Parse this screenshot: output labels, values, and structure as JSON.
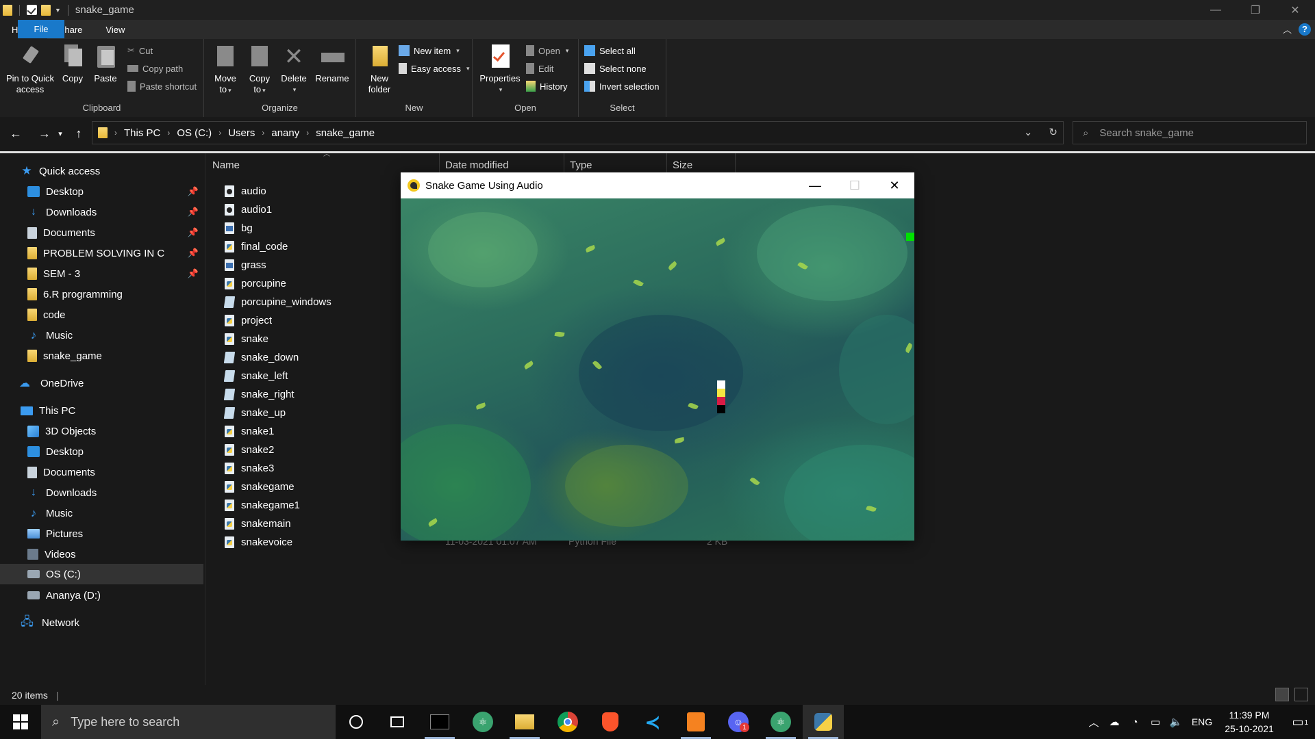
{
  "explorer": {
    "window_title": "snake_game",
    "tabs": [
      "File",
      "Home",
      "Share",
      "View"
    ],
    "ribbon": {
      "clipboard": {
        "label": "Clipboard",
        "pin": "Pin to Quick access",
        "pin_l1": "Pin to Quick",
        "pin_l2": "access",
        "copy": "Copy",
        "paste": "Paste",
        "cut": "Cut",
        "copy_path": "Copy path",
        "paste_shortcut": "Paste shortcut"
      },
      "organize": {
        "label": "Organize",
        "move_l1": "Move",
        "move_l2": "to",
        "copy_l1": "Copy",
        "copy_l2": "to",
        "delete": "Delete",
        "rename": "Rename"
      },
      "new": {
        "label": "New",
        "folder_l1": "New",
        "folder_l2": "folder",
        "new_item": "New item",
        "easy_access": "Easy access"
      },
      "open": {
        "label": "Open",
        "properties": "Properties",
        "open": "Open",
        "edit": "Edit",
        "history": "History"
      },
      "select": {
        "label": "Select",
        "select_all": "Select all",
        "select_none": "Select none",
        "invert": "Invert selection"
      }
    },
    "breadcrumb": [
      "This PC",
      "OS (C:)",
      "Users",
      "anany",
      "snake_game"
    ],
    "search_placeholder": "Search snake_game",
    "nav": {
      "quick_access": "Quick access",
      "quick_items": [
        {
          "label": "Desktop",
          "pinned": true
        },
        {
          "label": "Downloads",
          "pinned": true
        },
        {
          "label": "Documents",
          "pinned": true
        },
        {
          "label": "PROBLEM SOLVING IN C",
          "pinned": true
        },
        {
          "label": "SEM - 3",
          "pinned": true
        },
        {
          "label": "6.R programming",
          "pinned": false
        },
        {
          "label": "code",
          "pinned": false
        },
        {
          "label": "Music",
          "pinned": false
        },
        {
          "label": "snake_game",
          "pinned": false
        }
      ],
      "onedrive": "OneDrive",
      "this_pc": "This PC",
      "pc_items": [
        "3D Objects",
        "Desktop",
        "Documents",
        "Downloads",
        "Music",
        "Pictures",
        "Videos",
        "OS (C:)",
        "Ananya (D:)"
      ],
      "network": "Network"
    },
    "columns": {
      "name": "Name",
      "date": "Date modified",
      "type": "Type",
      "size": "Size"
    },
    "files": [
      {
        "name": "audio",
        "icon": "audio-file-icon"
      },
      {
        "name": "audio1",
        "icon": "audio-file-icon"
      },
      {
        "name": "bg",
        "icon": "image-file-icon"
      },
      {
        "name": "final_code",
        "icon": "python-file-icon"
      },
      {
        "name": "grass",
        "icon": "image-file-icon"
      },
      {
        "name": "porcupine",
        "icon": "python-file-icon"
      },
      {
        "name": "porcupine_windows",
        "icon": "python-windowed-file-icon"
      },
      {
        "name": "project",
        "icon": "python-file-icon"
      },
      {
        "name": "snake",
        "icon": "python-file-icon"
      },
      {
        "name": "snake_down",
        "icon": "python-windowed-file-icon"
      },
      {
        "name": "snake_left",
        "icon": "python-windowed-file-icon"
      },
      {
        "name": "snake_right",
        "icon": "python-windowed-file-icon"
      },
      {
        "name": "snake_up",
        "icon": "python-windowed-file-icon"
      },
      {
        "name": "snake1",
        "icon": "python-file-icon"
      },
      {
        "name": "snake2",
        "icon": "python-file-icon"
      },
      {
        "name": "snake3",
        "icon": "python-file-icon"
      },
      {
        "name": "snakegame",
        "icon": "python-file-icon"
      },
      {
        "name": "snakegame1",
        "icon": "python-file-icon"
      },
      {
        "name": "snakemain",
        "icon": "python-file-icon"
      },
      {
        "name": "snakevoice",
        "icon": "python-file-icon"
      }
    ],
    "visible_last_row": {
      "date": "11-03-2021 01:07 AM",
      "type": "Python File",
      "size": "2 KB"
    },
    "status": "20 items"
  },
  "game": {
    "title": "Snake Game Using Audio",
    "snake_colors": [
      "#ffffff",
      "#f5e642",
      "#d81b45",
      "#000000"
    ],
    "food_color": "#00e000"
  },
  "taskbar": {
    "search_placeholder": "Type here to search",
    "apps": [
      "cortana-icon",
      "task-view-icon",
      "terminal-icon",
      "atom-icon",
      "file-explorer-icon",
      "chrome-icon",
      "brave-icon",
      "vscode-icon",
      "pdf-editor-icon",
      "discord-icon",
      "atom-icon",
      "python-icon"
    ],
    "discord_badge": "1",
    "lang": "ENG",
    "time": "11:39 PM",
    "date": "25-10-2021",
    "notif_count": "1"
  }
}
